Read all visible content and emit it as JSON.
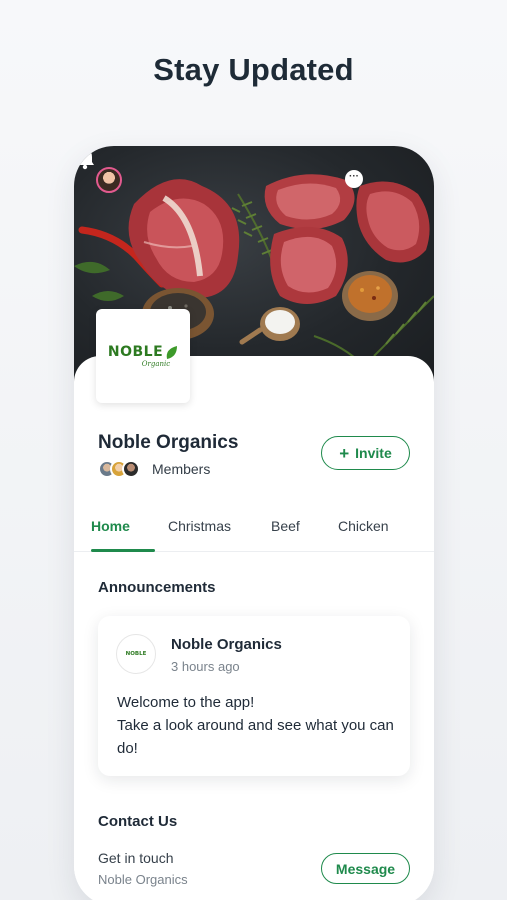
{
  "headline": "Stay Updated",
  "header_icons": {
    "avatar": "profile-avatar",
    "chat": "chat-bubble-icon",
    "chat_glyph": "···",
    "bell": "bell-icon"
  },
  "site": {
    "logo_text": "NOBLE",
    "logo_subtext": "Organic",
    "name": "Noble Organics",
    "members_label": "Members",
    "invite_label": "Invite"
  },
  "tabs": [
    {
      "label": "Home",
      "active": true
    },
    {
      "label": "Christmas",
      "active": false
    },
    {
      "label": "Beef",
      "active": false
    },
    {
      "label": "Chicken",
      "active": false
    }
  ],
  "announcements": {
    "title": "Announcements",
    "post": {
      "logo_text": "NOBLE",
      "author": "Noble Organics",
      "time": "3 hours ago",
      "line1": "Welcome to the app!",
      "line2": "Take a look around and see what you can do!"
    }
  },
  "contact": {
    "title": "Contact Us",
    "subtitle": "Get in touch",
    "name": "Noble Organics",
    "message_label": "Message"
  },
  "colors": {
    "accent": "#1f8a4c",
    "logo_green": "#2d7a21",
    "text": "#1f2a37",
    "muted": "#7a838c"
  }
}
